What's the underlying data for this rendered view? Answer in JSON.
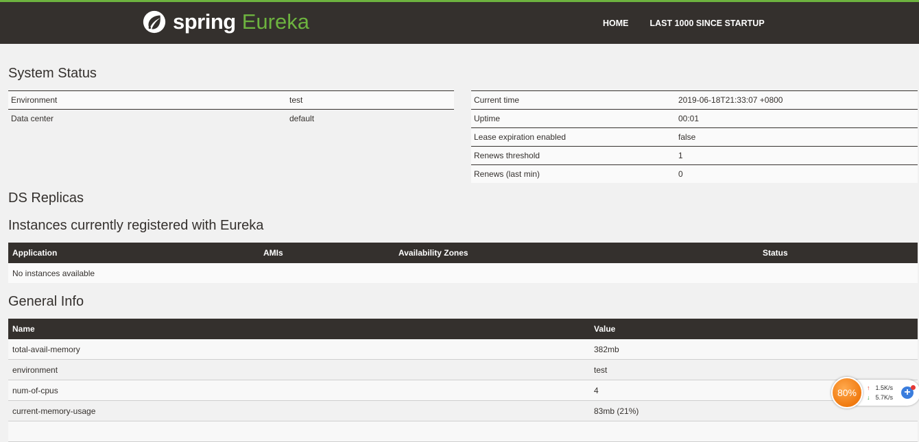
{
  "header": {
    "brand_spring": "spring",
    "brand_eureka": "Eureka",
    "nav": [
      {
        "label": "HOME"
      },
      {
        "label": "LAST 1000 SINCE STARTUP"
      }
    ],
    "colors": {
      "bar": "#34302d",
      "accent": "#6db33f"
    }
  },
  "system_status": {
    "title": "System Status",
    "left": [
      {
        "key": "Environment",
        "value": "test"
      },
      {
        "key": "Data center",
        "value": "default"
      }
    ],
    "right": [
      {
        "key": "Current time",
        "value": "2019-06-18T21:33:07 +0800"
      },
      {
        "key": "Uptime",
        "value": "00:01"
      },
      {
        "key": "Lease expiration enabled",
        "value": "false"
      },
      {
        "key": "Renews threshold",
        "value": "1"
      },
      {
        "key": "Renews (last min)",
        "value": "0"
      }
    ]
  },
  "ds_replicas": {
    "title": "DS Replicas"
  },
  "instances": {
    "title": "Instances currently registered with Eureka",
    "columns": [
      "Application",
      "AMIs",
      "Availability Zones",
      "Status"
    ],
    "empty_message": "No instances available"
  },
  "general_info": {
    "title": "General Info",
    "columns": [
      "Name",
      "Value"
    ],
    "rows": [
      {
        "name": "total-avail-memory",
        "value": "382mb"
      },
      {
        "name": "environment",
        "value": "test"
      },
      {
        "name": "num-of-cpus",
        "value": "4"
      },
      {
        "name": "current-memory-usage",
        "value": "83mb (21%)"
      }
    ]
  },
  "net_widget": {
    "percent": "80%",
    "upload": "1.5K/s",
    "download": "5.7K/s",
    "up_arrow": "↑",
    "down_arrow": "↓",
    "plus": "+"
  }
}
